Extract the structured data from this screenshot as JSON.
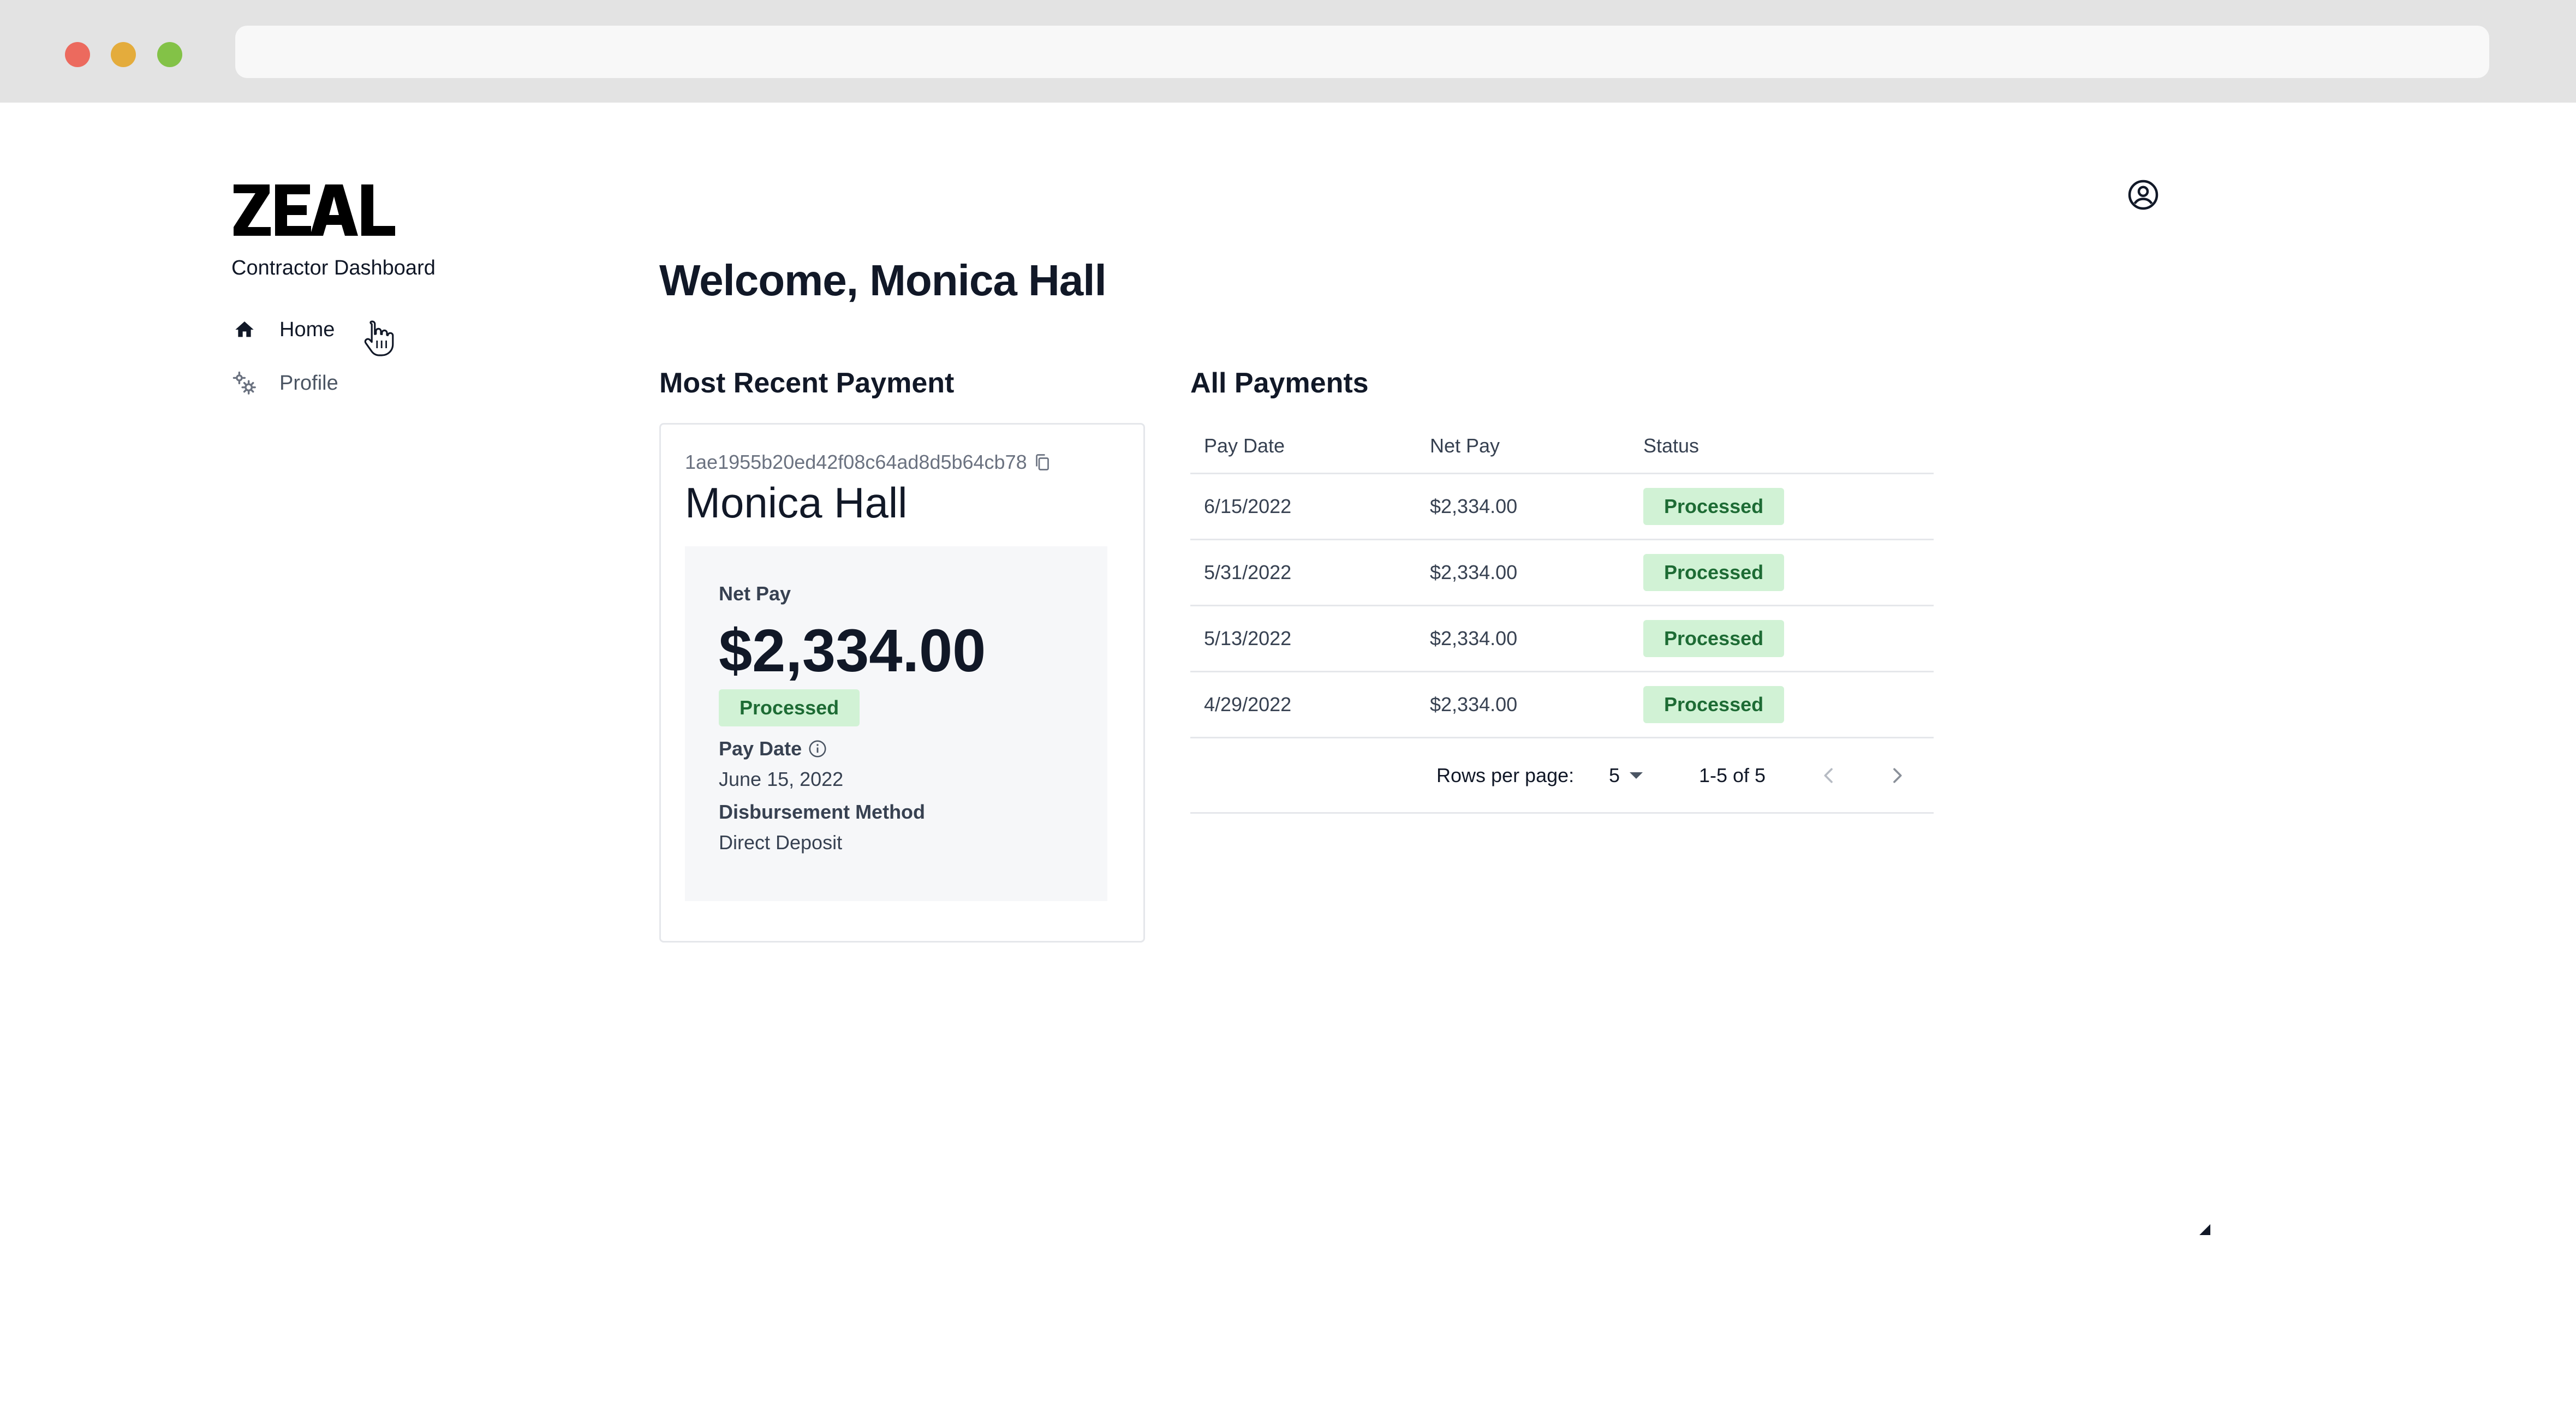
{
  "brand": {
    "logo_text": "ZEAL",
    "subtitle": "Contractor Dashboard"
  },
  "sidebar": {
    "items": [
      {
        "label": "Home",
        "icon": "home-icon",
        "active": true
      },
      {
        "label": "Profile",
        "icon": "gears-icon",
        "active": false
      }
    ]
  },
  "header": {
    "account_icon": "account-circle-icon"
  },
  "main": {
    "welcome": "Welcome, Monica Hall",
    "recent_title": "Most Recent Payment",
    "all_title": "All Payments"
  },
  "recent_payment": {
    "id": "1ae1955b20ed42f08c64ad8d5b64cb78",
    "name": "Monica Hall",
    "net_pay_label": "Net Pay",
    "net_pay_amount": "$2,334.00",
    "status": "Processed",
    "pay_date_label": "Pay Date",
    "pay_date_value": "June 15, 2022",
    "disbursement_label": "Disbursement Method",
    "disbursement_value": "Direct Deposit"
  },
  "payments_table": {
    "columns": [
      "Pay Date",
      "Net Pay",
      "Status"
    ],
    "rows": [
      {
        "pay_date": "6/15/2022",
        "net_pay": "$2,334.00",
        "status": "Processed"
      },
      {
        "pay_date": "5/31/2022",
        "net_pay": "$2,334.00",
        "status": "Processed"
      },
      {
        "pay_date": "5/13/2022",
        "net_pay": "$2,334.00",
        "status": "Processed"
      },
      {
        "pay_date": "4/29/2022",
        "net_pay": "$2,334.00",
        "status": "Processed"
      }
    ],
    "pagination": {
      "rows_per_page_label": "Rows per page:",
      "rows_per_page_value": "5",
      "range": "1-5 of 5"
    }
  },
  "colors": {
    "badge_bg": "#d1f2d5",
    "badge_text": "#1d6b34",
    "chrome": "#e3e3e3"
  }
}
